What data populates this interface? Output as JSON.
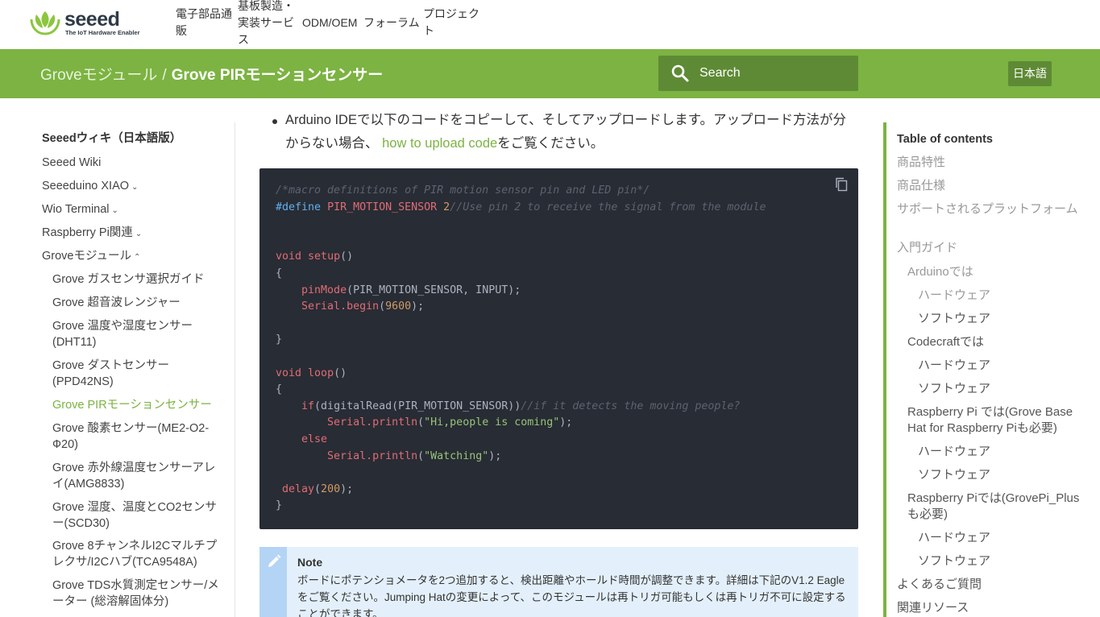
{
  "brand": {
    "logo_text": "seeed",
    "logo_tagline": "The IoT Hardware Enabler",
    "colors": {
      "primary_green": "#7cb342",
      "dark_green": "#5e8a35",
      "code_bg": "#282c34",
      "note_bg": "#e3f0fb"
    }
  },
  "topnav": {
    "items": [
      {
        "label": "電子部品通販"
      },
      {
        "label": "基板製造・実装サービス"
      },
      {
        "label": "ODM/OEM"
      },
      {
        "label": "フォーラム"
      },
      {
        "label": "プロジェクト"
      }
    ]
  },
  "header": {
    "breadcrumb_parent": "Groveモジュール",
    "breadcrumb_sep": "/",
    "breadcrumb_current": "Grove PIRモーションセンサー",
    "search_icon": "search-icon",
    "search_label": "Search",
    "language": "日本語"
  },
  "sidebar": {
    "title": "Seeedウィキ（日本語版）",
    "items": [
      {
        "label": "Seeed Wiki"
      },
      {
        "label": "Seeeduino XIAO",
        "chevron": "⌄"
      },
      {
        "label": "Wio Terminal",
        "chevron": "⌄"
      },
      {
        "label": "Raspberry Pi関連",
        "chevron": "⌄"
      },
      {
        "label": "Groveモジュール",
        "chevron": "⌃"
      },
      {
        "label": "Grove ガスセンサ選択ガイド"
      },
      {
        "label": "Grove 超音波レンジャー"
      },
      {
        "label": "Grove 温度や湿度センサー(DHT11)"
      },
      {
        "label": "Grove ダストセンサー(PPD42NS)"
      },
      {
        "label": "Grove PIRモーションセンサー"
      },
      {
        "label": "Grove 酸素センサー(ME2-O2-Ф20)"
      },
      {
        "label": "Grove 赤外線温度センサーアレイ(AMG8833)"
      },
      {
        "label": "Grove 湿度、温度とCO2センサー(SCD30)"
      },
      {
        "label": "Grove 8チャンネルI2Cマルチプレクサ/I2Cハブ(TCA9548A)"
      },
      {
        "label": "Grove TDS水質測定センサー/メーター (総溶解固体分)"
      }
    ]
  },
  "main": {
    "instruction_text": "Arduino IDEで以下のコードをコピーして、そしてアップロードします。アップロード方法が分からない場合、",
    "instruction_link": "how to upload code",
    "instruction_suffix": "をご覧ください。",
    "copy_icon": "copy-icon",
    "code": {
      "comment_macro": "/*macro definitions of PIR motion sensor pin and LED pin*/",
      "define_kw": "#define",
      "define_name": "PIR_MOTION_SENSOR",
      "define_value": "2",
      "define_comment": "//Use pin 2 to receive the signal from the module",
      "void_kw": "void",
      "setup_fn": "setup",
      "paren_open_close": "()",
      "brace_open": "{",
      "brace_close": "}",
      "pinmode_fn": "pinMode",
      "pinmode_args": "(PIR_MOTION_SENSOR, INPUT);",
      "serial_obj": "Serial",
      "begin_fn": ".begin",
      "begin_open": "(",
      "baud": "9600",
      "begin_close": ");",
      "loop_fn": "loop",
      "if_kw": "if",
      "if_cond": "(digitalRead(PIR_MOTION_SENSOR))",
      "if_comment": "//if it detects the moving people?",
      "println_fn": ".println",
      "println_open": "(",
      "str_hi": "\"Hi,people is coming\"",
      "println_close": ");",
      "else_kw": "else",
      "str_watching": "\"Watching\"",
      "delay_fn": "delay",
      "delay_open": "(",
      "delay_val": "200",
      "delay_close": ");"
    },
    "note": {
      "icon": "pencil-icon",
      "title": "Note",
      "text": "ボードにポテンショメータを2つ追加すると、検出距離やホールド時間が調整できます。詳細は下記のV1.2 Eagleをご覧ください。Jumping Hatの変更によって、このモジュールは再トリガ可能もしくは再トリガ不可に設定することができます。"
    }
  },
  "toc": {
    "title": "Table of contents",
    "items": [
      {
        "label": "商品特性"
      },
      {
        "label": "商品仕様"
      },
      {
        "label": "サポートされるプラットフォーム"
      },
      {
        "label": "入門ガイド"
      },
      {
        "label": "Arduinoでは"
      },
      {
        "label": "ハードウェア"
      },
      {
        "label": "ソフトウェア"
      },
      {
        "label": "Codecraftでは"
      },
      {
        "label": "ハードウェア"
      },
      {
        "label": "ソフトウェア"
      },
      {
        "label": "Raspberry Pi では(Grove Base Hat for Raspberry Piも必要)"
      },
      {
        "label": "ハードウェア"
      },
      {
        "label": "ソフトウェア"
      },
      {
        "label": "Raspberry Piでは(GrovePi_Plusも必要)"
      },
      {
        "label": "ハードウェア"
      },
      {
        "label": "ソフトウェア"
      },
      {
        "label": "よくあるご質問"
      },
      {
        "label": "関連リソース"
      }
    ]
  }
}
